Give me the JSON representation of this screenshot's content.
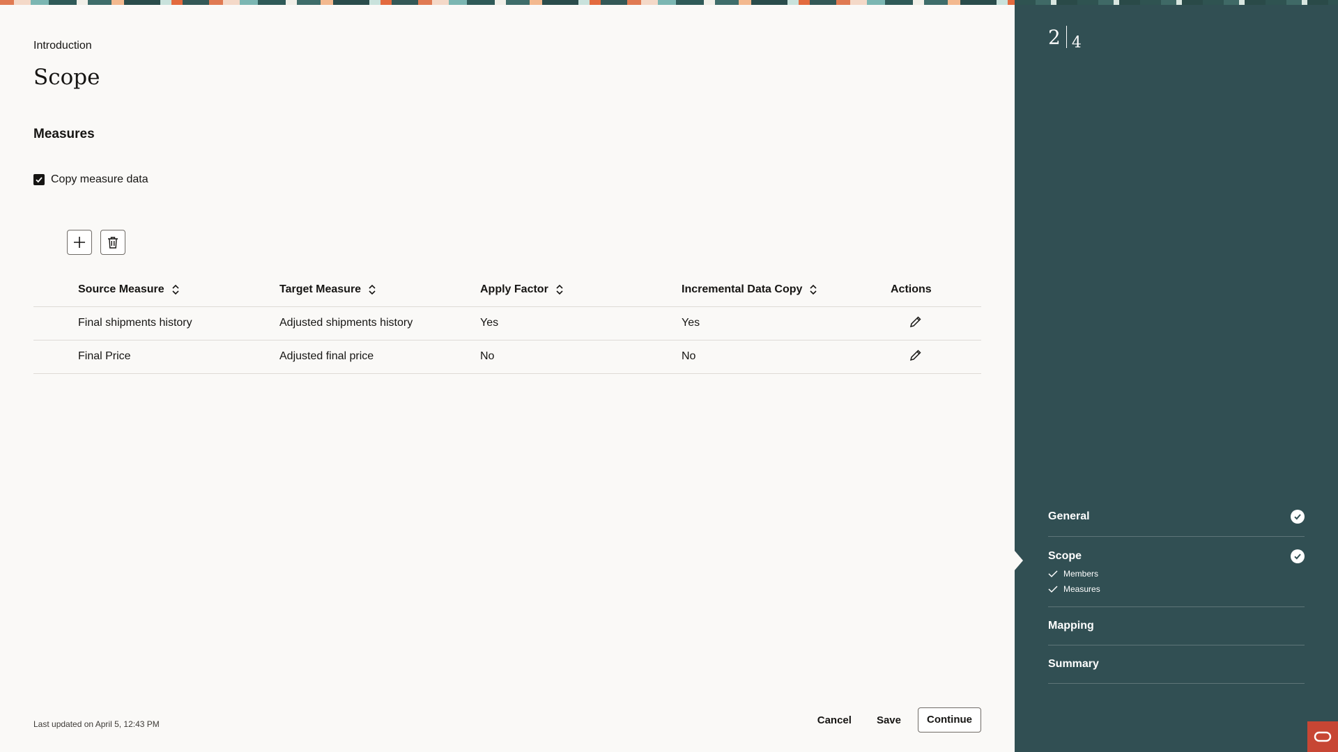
{
  "breadcrumb": "Introduction",
  "page_title": "Scope",
  "section_title": "Measures",
  "copy_measure": {
    "label": "Copy measure data",
    "checked": true
  },
  "toolbar": {
    "add_icon": "plus-icon",
    "delete_icon": "trash-icon"
  },
  "table": {
    "columns": [
      {
        "label": "Source Measure",
        "sortable": true
      },
      {
        "label": "Target Measure",
        "sortable": true
      },
      {
        "label": "Apply Factor",
        "sortable": true
      },
      {
        "label": "Incremental Data Copy",
        "sortable": true
      },
      {
        "label": "Actions",
        "sortable": false
      }
    ],
    "rows": [
      {
        "source": "Final shipments history",
        "target": "Adjusted shipments history",
        "apply_factor": "Yes",
        "incremental": "Yes",
        "action_icon": "pencil-icon"
      },
      {
        "source": "Final Price",
        "target": "Adjusted final price",
        "apply_factor": "No",
        "incremental": "No",
        "action_icon": "pencil-icon"
      }
    ]
  },
  "footer": {
    "last_updated": "Last updated on April 5, 12:43 PM",
    "cancel": "Cancel",
    "save": "Save",
    "continue": "Continue"
  },
  "stepper": {
    "current": "2",
    "total": "4",
    "steps": [
      {
        "label": "General",
        "completed": true
      },
      {
        "label": "Scope",
        "completed": true,
        "current": true,
        "substeps": [
          "Members",
          "Measures"
        ]
      },
      {
        "label": "Mapping",
        "completed": false
      },
      {
        "label": "Summary",
        "completed": false
      }
    ]
  },
  "colors": {
    "side_panel": "#314f53",
    "accent": "#c74634",
    "background": "#faf9f7"
  }
}
